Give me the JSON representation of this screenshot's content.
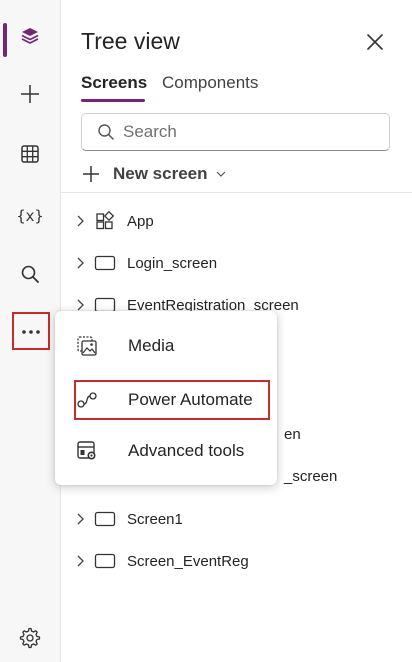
{
  "colors": {
    "accent": "#742774",
    "highlight": "#c42b2b"
  },
  "rail": {
    "items": [
      {
        "name": "layers-icon",
        "active": true
      },
      {
        "name": "plus-icon"
      },
      {
        "name": "table-icon"
      },
      {
        "name": "variables-icon",
        "label": "{x}"
      },
      {
        "name": "search-icon"
      },
      {
        "name": "more-icon",
        "label": "..."
      },
      {
        "name": "settings-icon"
      }
    ]
  },
  "panel": {
    "title": "Tree view",
    "tabs": [
      {
        "label": "Screens",
        "selected": true
      },
      {
        "label": "Components",
        "selected": false
      }
    ],
    "search": {
      "placeholder": "Search",
      "value": ""
    },
    "new_screen": {
      "label": "New screen"
    },
    "tree": [
      {
        "label": "App",
        "icon": "app-icon"
      },
      {
        "label": "Login_screen",
        "icon": "screen-icon"
      },
      {
        "label": "EventRegistration_screen",
        "icon": "screen-icon"
      },
      {
        "label": "en",
        "icon": "screen-icon"
      },
      {
        "label": "_screen",
        "icon": "screen-icon"
      },
      {
        "label": "Screen1",
        "icon": "screen-icon"
      },
      {
        "label": "Screen_EventReg",
        "icon": "screen-icon"
      }
    ]
  },
  "menu": {
    "items": [
      {
        "label": "Media",
        "icon": "media-icon"
      },
      {
        "label": "Power Automate",
        "icon": "power-automate-icon",
        "highlighted": true
      },
      {
        "label": "Advanced tools",
        "icon": "advanced-tools-icon"
      }
    ]
  }
}
